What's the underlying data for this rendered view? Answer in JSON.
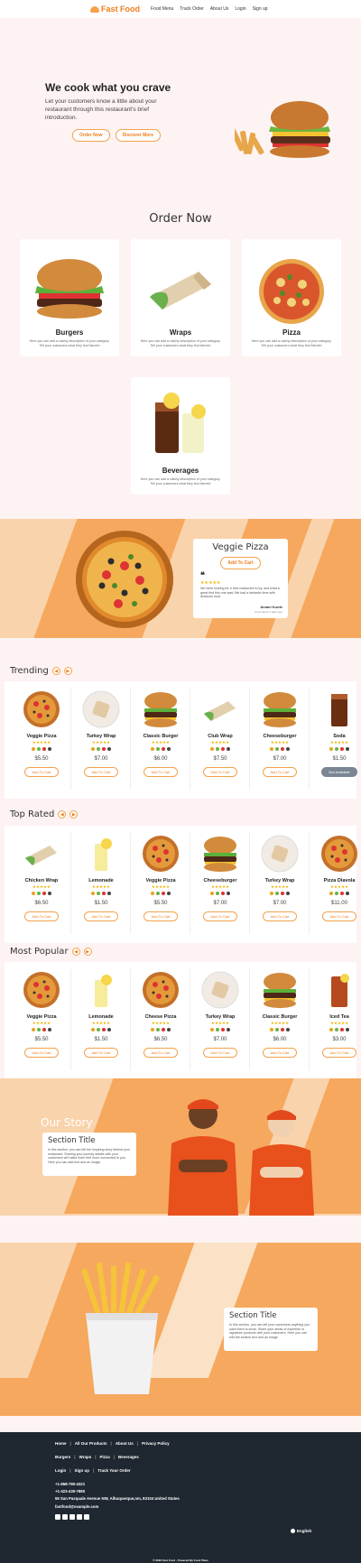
{
  "nav": {
    "brand": "Fast Food",
    "links": [
      "Food Menu",
      "Track Order",
      "About Us",
      "Login",
      "Sign up"
    ]
  },
  "hero": {
    "title": "We cook what you crave",
    "subtitle": "Let your customers know a little about your restaurant through this restaurant's brief introduction.",
    "order_btn": "Order Now",
    "discover_btn": "Discover More"
  },
  "order_section_title": "Order Now",
  "categories": [
    {
      "name": "Burgers",
      "desc": "Here you can add a catchy description of your category. Tell your customers what they find therein!"
    },
    {
      "name": "Wraps",
      "desc": "Here you can add a catchy description of your category. Tell your customers what they find therein!"
    },
    {
      "name": "Pizza",
      "desc": "Here you can add a catchy description of your category. Tell your customers what they find therein!"
    },
    {
      "name": "Beverages",
      "desc": "Here you can add a catchy description of your category. Tell your customers what they find therein!"
    }
  ],
  "promo": {
    "title": "Veggie Pizza",
    "button": "Add To Cart",
    "stars": "★★★★★",
    "review": "We were looking for a new restaurant to try, and what a great find this one was! We had a fantastic time with delicious food.",
    "author": "Amani Kunte",
    "role": "since about 4 days ago"
  },
  "rows": [
    {
      "title": "Trending",
      "items": [
        {
          "name": "Veggie Pizza",
          "price": "$5.50",
          "btn": "Add To Cart"
        },
        {
          "name": "Turkey Wrap",
          "price": "$7.00",
          "btn": "Add To Cart"
        },
        {
          "name": "Classic Burger",
          "price": "$6.00",
          "btn": "Add To Cart"
        },
        {
          "name": "Club Wrap",
          "price": "$7.50",
          "btn": "Add To Cart"
        },
        {
          "name": "Cheeseburger",
          "price": "$7.00",
          "btn": "Add To Cart"
        },
        {
          "name": "Soda",
          "price": "$1.50",
          "btn": "Not Available"
        }
      ]
    },
    {
      "title": "Top Rated",
      "items": [
        {
          "name": "Chicken Wrap",
          "price": "$6.50",
          "btn": "Add To Cart"
        },
        {
          "name": "Lemonade",
          "price": "$1.50",
          "btn": "Add To Cart"
        },
        {
          "name": "Veggie Pizza",
          "price": "$5.50",
          "btn": "Add To Cart"
        },
        {
          "name": "Cheeseburger",
          "price": "$7.00",
          "btn": "Add To Cart"
        },
        {
          "name": "Turkey Wrap",
          "price": "$7.00",
          "btn": "Add To Cart"
        },
        {
          "name": "Pizza Diavola",
          "price": "$11.00",
          "btn": "Add To Cart"
        }
      ]
    },
    {
      "title": "Most Popular",
      "items": [
        {
          "name": "Veggie Pizza",
          "price": "$5.50",
          "btn": "Add To Cart"
        },
        {
          "name": "Lemonade",
          "price": "$1.50",
          "btn": "Add To Cart"
        },
        {
          "name": "Cheese Pizza",
          "price": "$6.50",
          "btn": "Add To Cart"
        },
        {
          "name": "Turkey Wrap",
          "price": "$7.00",
          "btn": "Add To Cart"
        },
        {
          "name": "Classic Burger",
          "price": "$6.00",
          "btn": "Add To Cart"
        },
        {
          "name": "Iced Tea",
          "price": "$3.00",
          "btn": "Add To Cart"
        }
      ]
    }
  ],
  "stars": "★★★★★",
  "story": {
    "label": "Our Story",
    "card_title": "Section Title",
    "card_body": "In this section, you can tell the inspiring story behind your restaurant. Sharing your journey details with your customers will make them feel more connected to you. Here you can add text and an image."
  },
  "fries": {
    "card_title": "Section Title",
    "card_body": "In this section, you can tell your customers anything you want them to know. Share your areas of expertise or signature products with your customers. Here you can edit the section text and an image."
  },
  "footer": {
    "row1": [
      "Home",
      "All Our Products",
      "About Us",
      "Privacy Policy"
    ],
    "row2": [
      "Burgers",
      "Wraps",
      "Pizza",
      "Beverages"
    ],
    "row3": [
      "Login",
      "Sign up",
      "Track Your Order"
    ],
    "phone1": "+1-858-780-4321",
    "phone2": "+1-323-430-7880",
    "address": "55 San Pasquale Avenue NW, Albuquerque,nm, 83104 United States",
    "email": "fastfood@example.com",
    "language": "English",
    "copyright": "© 2023 Fast Food - Powered By Food Place"
  },
  "colors": {
    "accent": "#f07d1a",
    "peach": "#f9d3ab",
    "orange": "#f5a85e",
    "footer_bg": "#1f2830"
  }
}
